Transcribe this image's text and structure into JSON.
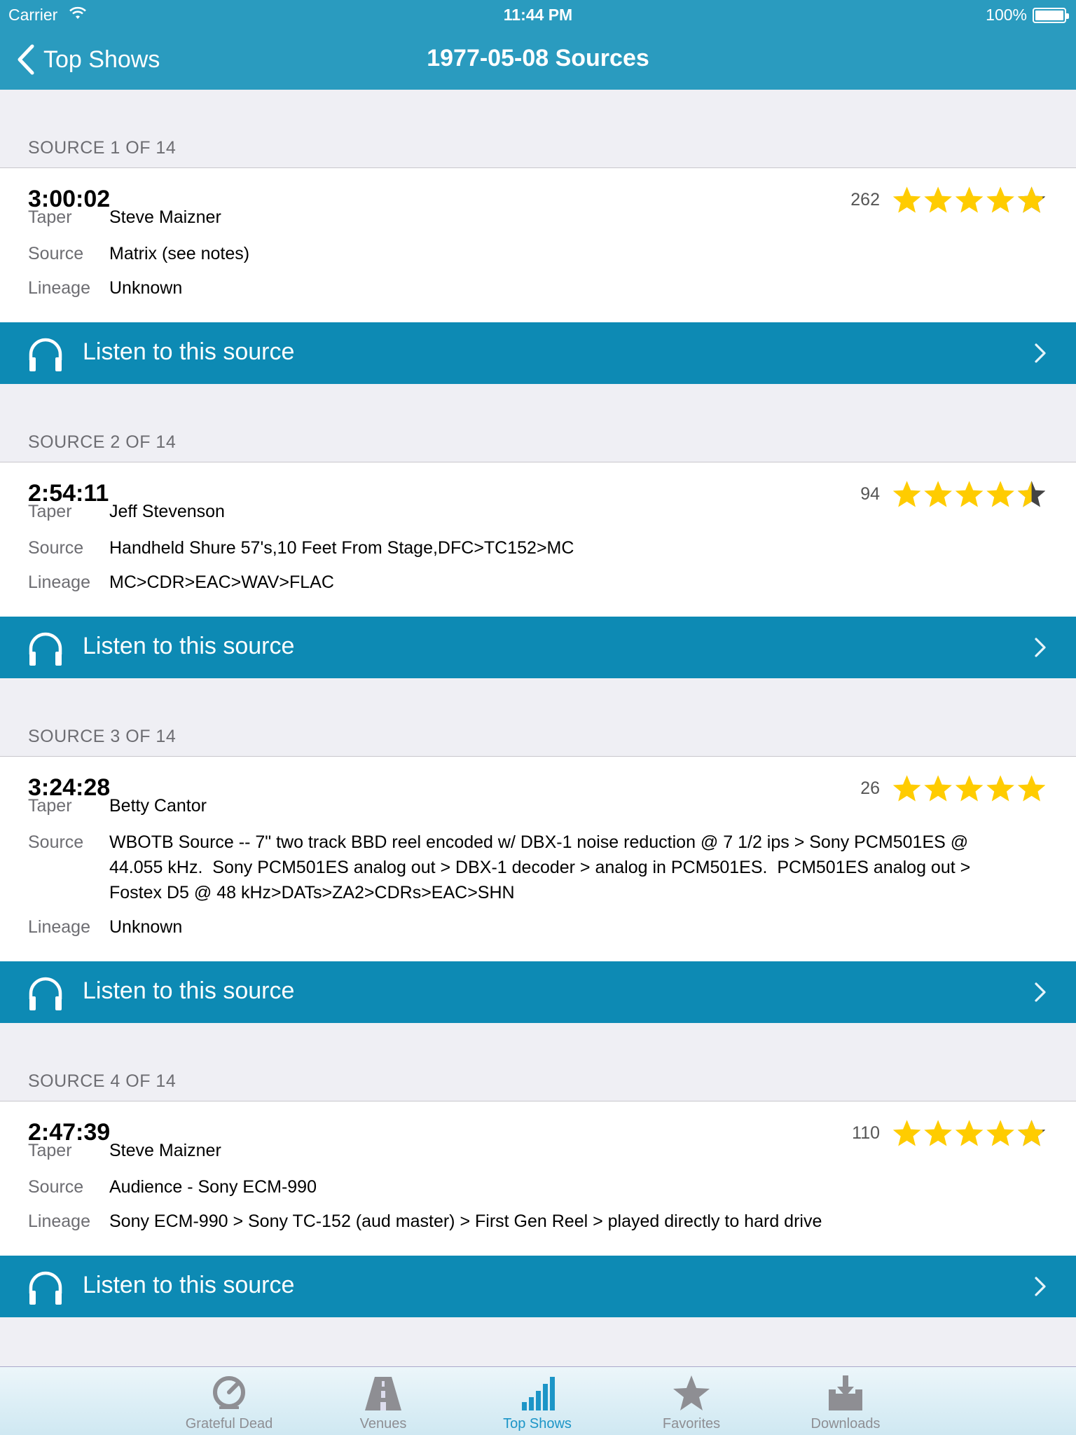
{
  "status_bar": {
    "carrier": "Carrier",
    "time": "11:44 PM",
    "battery": "100%"
  },
  "nav": {
    "back_label": "Top Shows",
    "title": "1977-05-08 Sources"
  },
  "field_labels": {
    "taper": "Taper",
    "source": "Source",
    "lineage": "Lineage"
  },
  "listen_label": "Listen to this source",
  "colors": {
    "nav_bg": "#2a9bbf",
    "listen_bg": "#0d8ab4",
    "star": "#ffcc00",
    "star_empty": "#444444",
    "tab_active": "#1c95c7"
  },
  "sources": [
    {
      "header": "SOURCE 1 OF 14",
      "duration": "3:00:02",
      "votes": "262",
      "rating": 4.9,
      "taper": "Steve Maizner",
      "source_lines": [
        "Matrix (see notes)"
      ],
      "lineage": "Unknown"
    },
    {
      "header": "SOURCE 2 OF 14",
      "duration": "2:54:11",
      "votes": "94",
      "rating": 4.5,
      "taper": "Jeff Stevenson",
      "source_lines": [
        "Handheld Shure 57's,10 Feet From Stage,DFC>TC152>MC"
      ],
      "lineage": "MC>CDR>EAC>WAV>FLAC"
    },
    {
      "header": "SOURCE 3 OF 14",
      "duration": "3:24:28",
      "votes": "26",
      "rating": 5,
      "taper": "Betty Cantor",
      "source_lines": [
        "WBOTB Source -- 7\" two track BBD reel encoded w/ DBX-1 noise reduction @ 7 1/2 ips > Sony PCM501ES @",
        "44.055 kHz.  Sony PCM501ES analog out > DBX-1 decoder > analog in PCM501ES.  PCM501ES analog out >",
        "Fostex D5 @ 48 kHz>DATs>ZA2>CDRs>EAC>SHN"
      ],
      "lineage": "Unknown"
    },
    {
      "header": "SOURCE 4 OF 14",
      "duration": "2:47:39",
      "votes": "110",
      "rating": 4.9,
      "taper": "Steve Maizner",
      "source_lines": [
        "Audience - Sony ECM-990"
      ],
      "lineage": "Sony ECM-990 > Sony TC-152 (aud master) > First Gen Reel > played directly to hard drive"
    }
  ],
  "tabs": [
    {
      "label": "Grateful Dead",
      "icon": "grateful-dead-icon",
      "active": false
    },
    {
      "label": "Venues",
      "icon": "road-icon",
      "active": false
    },
    {
      "label": "Top Shows",
      "icon": "bar-chart-icon",
      "active": true
    },
    {
      "label": "Favorites",
      "icon": "star-icon",
      "active": false
    },
    {
      "label": "Downloads",
      "icon": "download-tray-icon",
      "active": false
    }
  ]
}
